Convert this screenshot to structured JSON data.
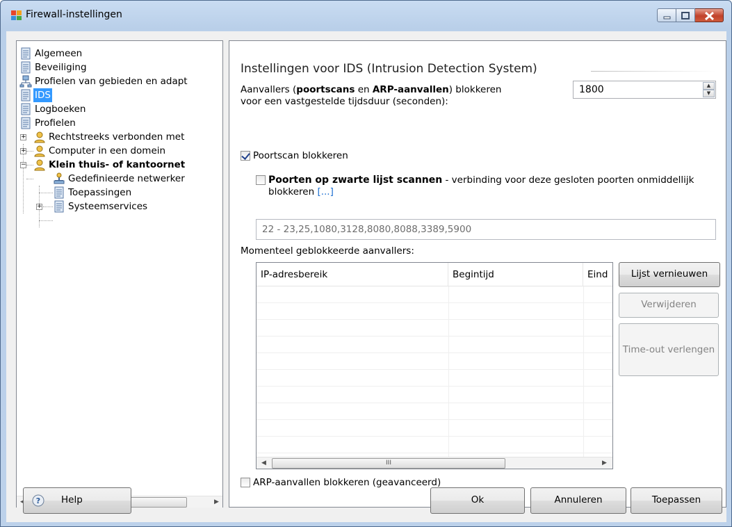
{
  "window": {
    "title": "Firewall-instellingen"
  },
  "tree": {
    "items": [
      {
        "label": "Algemeen"
      },
      {
        "label": "Beveiliging"
      },
      {
        "label": "Profielen van gebieden en adapt"
      },
      {
        "label": "IDS"
      },
      {
        "label": "Logboeken"
      },
      {
        "label": "Profielen"
      },
      {
        "label": "Rechtstreeks verbonden met"
      },
      {
        "label": "Computer in een domein"
      },
      {
        "label": "Klein thuis- of kantoornet"
      },
      {
        "label": "Gedefinieerde netwerker"
      },
      {
        "label": "Toepassingen"
      },
      {
        "label": "Systeemservices"
      }
    ],
    "scroll_thumb_glyph": "III"
  },
  "ids": {
    "section_title": "Instellingen voor IDS (Intrusion Detection System)",
    "attackers_text_1": "Aanvallers (",
    "attackers_bold_1": "poortscans",
    "attackers_text_2": " en ",
    "attackers_bold_2": "ARP-aanvallen",
    "attackers_text_3": ") blokkeren",
    "attackers_text_4": "voor een vastgestelde tijdsduur (seconden):",
    "block_duration": "1800",
    "portscan_label": "Poortscan blokkeren",
    "portscan_checked": true,
    "blacklist_bold": "Poorten op zwarte lijst scannen",
    "blacklist_text": " - verbinding voor deze gesloten poorten onmiddellijk blokkeren ",
    "blacklist_link": "[...]",
    "blacklist_checked": false,
    "ports_value": "22 - 23,25,1080,3128,8080,8088,3389,5900",
    "blocked_label": "Momenteel geblokkeerde aanvallers:",
    "columns": [
      "IP-adresbereik",
      "Begintijd",
      "Eind"
    ],
    "rows": [],
    "scroll_thumb_glyph": "III",
    "arp_label": "ARP-aanvallen blokkeren (geavanceerd)",
    "arp_checked": false
  },
  "side_buttons": {
    "refresh": "Lijst vernieuwen",
    "remove": "Verwijderen",
    "extend": "Time-out verlengen"
  },
  "footer": {
    "help": "Help",
    "ok": "Ok",
    "cancel": "Annuleren",
    "apply": "Toepassen"
  }
}
